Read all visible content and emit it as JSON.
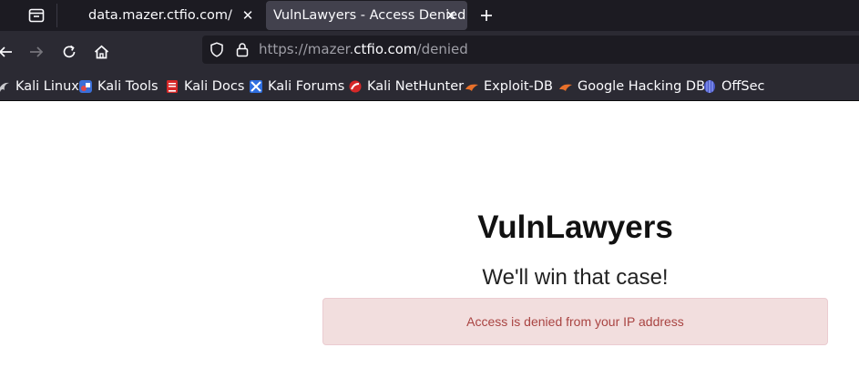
{
  "browser": {
    "tabs": [
      {
        "title": "data.mazer.ctfio.com/",
        "active": false
      },
      {
        "title": "VulnLawyers - Access Denied",
        "active": true
      }
    ],
    "url": {
      "scheme": "https://",
      "subdomain": "mazer.",
      "host": "ctfio.com",
      "path": "/denied"
    },
    "bookmarks": [
      {
        "label": "Kali Linux",
        "icon": "kali-dragon-icon"
      },
      {
        "label": "Kali Tools",
        "icon": "kali-tools-icon"
      },
      {
        "label": "Kali Docs",
        "icon": "kali-docs-icon"
      },
      {
        "label": "Kali Forums",
        "icon": "kali-forums-icon"
      },
      {
        "label": "Kali NetHunter",
        "icon": "kali-nethunter-icon"
      },
      {
        "label": "Exploit-DB",
        "icon": "exploit-db-icon"
      },
      {
        "label": "Google Hacking DB",
        "icon": "ghdb-icon"
      },
      {
        "label": "OffSec",
        "icon": "offsec-icon"
      }
    ]
  },
  "page": {
    "title": "VulnLawyers",
    "tagline": "We'll win that case!",
    "alert": "Access is denied from your IP address"
  },
  "colors": {
    "tabbar_bg": "#1c1b22",
    "toolbar_bg": "#2b2a33",
    "active_tab_bg": "#42414d",
    "alert_bg": "#f2dede",
    "alert_border": "#ebccd1",
    "alert_text": "#a94442"
  }
}
